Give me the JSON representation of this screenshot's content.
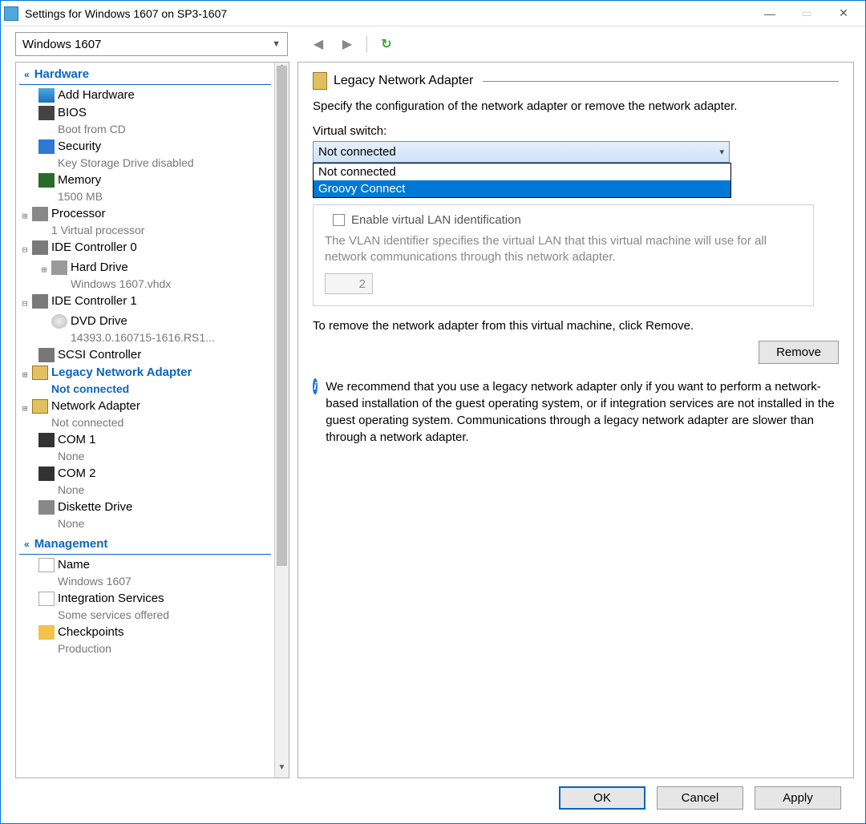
{
  "window": {
    "title": "Settings for Windows 1607 on SP3-1607"
  },
  "vm_selector": {
    "value": "Windows 1607"
  },
  "sections": {
    "hardware": "Hardware",
    "management": "Management"
  },
  "tree": {
    "add_hardware": "Add Hardware",
    "bios": {
      "label": "BIOS",
      "sub": "Boot from CD"
    },
    "security": {
      "label": "Security",
      "sub": "Key Storage Drive disabled"
    },
    "memory": {
      "label": "Memory",
      "sub": "1500 MB"
    },
    "processor": {
      "label": "Processor",
      "sub": "1 Virtual processor"
    },
    "ide0": {
      "label": "IDE Controller 0",
      "child_label": "Hard Drive",
      "child_sub": "Windows 1607.vhdx"
    },
    "ide1": {
      "label": "IDE Controller 1",
      "child_label": "DVD Drive",
      "child_sub": "14393.0.160715-1616.RS1..."
    },
    "scsi": "SCSI Controller",
    "legacy_nic": {
      "label": "Legacy Network Adapter",
      "sub": "Not connected"
    },
    "nic": {
      "label": "Network Adapter",
      "sub": "Not connected"
    },
    "com1": {
      "label": "COM 1",
      "sub": "None"
    },
    "com2": {
      "label": "COM 2",
      "sub": "None"
    },
    "diskette": {
      "label": "Diskette Drive",
      "sub": "None"
    },
    "name": {
      "label": "Name",
      "sub": "Windows 1607"
    },
    "integration": {
      "label": "Integration Services",
      "sub": "Some services offered"
    },
    "checkpoints": {
      "label": "Checkpoints",
      "sub": "Production"
    }
  },
  "panel": {
    "title": "Legacy Network Adapter",
    "intro": "Specify the configuration of the network adapter or remove the network adapter.",
    "switch_label": "Virtual switch:",
    "switch_value": "Not connected",
    "switch_options": [
      "Not connected",
      "Groovy Connect"
    ],
    "vlan_check": "Enable virtual LAN identification",
    "vlan_text": "The VLAN identifier specifies the virtual LAN that this virtual machine will use for all network communications through this network adapter.",
    "vlan_value": "2",
    "remove_text": "To remove the network adapter from this virtual machine, click Remove.",
    "remove_btn": "Remove",
    "info": "We recommend that you use a legacy network adapter only if you want to perform a network-based installation of the guest operating system, or if integration services are not installed in the guest operating system. Communications through a legacy network adapter are slower than through a network adapter."
  },
  "buttons": {
    "ok": "OK",
    "cancel": "Cancel",
    "apply": "Apply"
  }
}
